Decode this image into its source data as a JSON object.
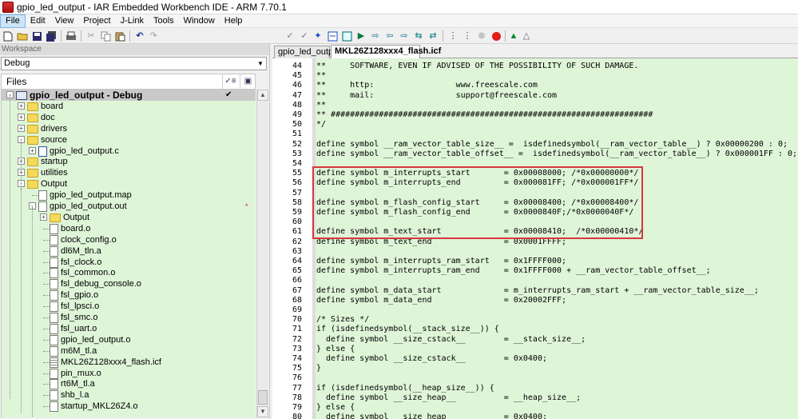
{
  "window": {
    "title": "gpio_led_output - IAR Embedded Workbench IDE - ARM 7.70.1"
  },
  "menu": [
    "File",
    "Edit",
    "View",
    "Project",
    "J-Link",
    "Tools",
    "Window",
    "Help"
  ],
  "workspace": {
    "header": "Workspace",
    "config": "Debug",
    "files_header": "Files",
    "tree": [
      {
        "label": "gpio_led_output - Debug",
        "depth": 0,
        "type": "project",
        "exp": "-",
        "bold": true,
        "selected": true,
        "check": "✔"
      },
      {
        "label": "board",
        "depth": 1,
        "type": "folder",
        "exp": "+"
      },
      {
        "label": "doc",
        "depth": 1,
        "type": "folder",
        "exp": "+"
      },
      {
        "label": "drivers",
        "depth": 1,
        "type": "folder",
        "exp": "+"
      },
      {
        "label": "source",
        "depth": 1,
        "type": "folder",
        "exp": "-"
      },
      {
        "label": "gpio_led_output.c",
        "depth": 2,
        "type": "cfile",
        "exp": "+"
      },
      {
        "label": "startup",
        "depth": 1,
        "type": "folder",
        "exp": "+"
      },
      {
        "label": "utilities",
        "depth": 1,
        "type": "folder",
        "exp": "+"
      },
      {
        "label": "Output",
        "depth": 1,
        "type": "folder",
        "exp": "-"
      },
      {
        "label": "gpio_led_output.map",
        "depth": 2,
        "type": "file",
        "exp": ""
      },
      {
        "label": "gpio_led_output.out",
        "depth": 2,
        "type": "file",
        "exp": "-",
        "mark": "*"
      },
      {
        "label": "Output",
        "depth": 3,
        "type": "folder",
        "exp": "+"
      },
      {
        "label": "board.o",
        "depth": 3,
        "type": "file",
        "exp": ""
      },
      {
        "label": "clock_config.o",
        "depth": 3,
        "type": "file",
        "exp": ""
      },
      {
        "label": "dl6M_tln.a",
        "depth": 3,
        "type": "file",
        "exp": ""
      },
      {
        "label": "fsl_clock.o",
        "depth": 3,
        "type": "file",
        "exp": ""
      },
      {
        "label": "fsl_common.o",
        "depth": 3,
        "type": "file",
        "exp": ""
      },
      {
        "label": "fsl_debug_console.o",
        "depth": 3,
        "type": "file",
        "exp": ""
      },
      {
        "label": "fsl_gpio.o",
        "depth": 3,
        "type": "file",
        "exp": ""
      },
      {
        "label": "fsl_lpsci.o",
        "depth": 3,
        "type": "file",
        "exp": ""
      },
      {
        "label": "fsl_smc.o",
        "depth": 3,
        "type": "file",
        "exp": ""
      },
      {
        "label": "fsl_uart.o",
        "depth": 3,
        "type": "file",
        "exp": ""
      },
      {
        "label": "gpio_led_output.o",
        "depth": 3,
        "type": "file",
        "exp": ""
      },
      {
        "label": "m6M_tl.a",
        "depth": 3,
        "type": "file",
        "exp": ""
      },
      {
        "label": "MKL26Z128xxx4_flash.icf",
        "depth": 3,
        "type": "filelines",
        "exp": ""
      },
      {
        "label": "pin_mux.o",
        "depth": 3,
        "type": "file",
        "exp": ""
      },
      {
        "label": "rt6M_tl.a",
        "depth": 3,
        "type": "file",
        "exp": ""
      },
      {
        "label": "shb_l.a",
        "depth": 3,
        "type": "file",
        "exp": ""
      },
      {
        "label": "startup_MKL26Z4.o",
        "depth": 3,
        "type": "file",
        "exp": ""
      }
    ]
  },
  "tabs": [
    {
      "label": "gpio_led_output",
      "active": false
    },
    {
      "label": "MKL26Z128xxx4_flash.icf",
      "active": true
    }
  ],
  "code": [
    {
      "n": "44",
      "t": "**     SOFTWARE, EVEN IF ADVISED OF THE POSSIBILITY OF SUCH DAMAGE."
    },
    {
      "n": "45",
      "t": "**"
    },
    {
      "n": "46",
      "t": "**     http:                 www.freescale.com"
    },
    {
      "n": "47",
      "t": "**     mail:                 support@freescale.com"
    },
    {
      "n": "48",
      "t": "**"
    },
    {
      "n": "49",
      "t": "** ###################################################################"
    },
    {
      "n": "50",
      "t": "*/"
    },
    {
      "n": "51",
      "t": ""
    },
    {
      "n": "52",
      "t": "define symbol __ram_vector_table_size__ =  isdefinedsymbol(__ram_vector_table__) ? 0x00000200 : 0;"
    },
    {
      "n": "53",
      "t": "define symbol __ram_vector_table_offset__ =  isdefinedsymbol(__ram_vector_table__) ? 0x000001FF : 0;"
    },
    {
      "n": "54",
      "t": ""
    },
    {
      "n": "55",
      "t": "define symbol m_interrupts_start       = 0x00008000; /*0x00000000*/"
    },
    {
      "n": "56",
      "t": "define symbol m_interrupts_end         = 0x000081FF; /*0x000001FF*/"
    },
    {
      "n": "57",
      "t": ""
    },
    {
      "n": "58",
      "t": "define symbol m_flash_config_start     = 0x00008400; /*0x00008400*/"
    },
    {
      "n": "59",
      "t": "define symbol m_flash_config_end       = 0x0000840F;/*0x0000040F*/"
    },
    {
      "n": "60",
      "t": ""
    },
    {
      "n": "61",
      "t": "define symbol m_text_start             = 0x00008410;  /*0x00000410*/"
    },
    {
      "n": "62",
      "t": "define symbol m_text_end               = 0x0001FFFF;"
    },
    {
      "n": "63",
      "t": ""
    },
    {
      "n": "64",
      "t": "define symbol m_interrupts_ram_start   = 0x1FFFF000;"
    },
    {
      "n": "65",
      "t": "define symbol m_interrupts_ram_end     = 0x1FFFF000 + __ram_vector_table_offset__;"
    },
    {
      "n": "66",
      "t": ""
    },
    {
      "n": "67",
      "t": "define symbol m_data_start             = m_interrupts_ram_start + __ram_vector_table_size__;"
    },
    {
      "n": "68",
      "t": "define symbol m_data_end               = 0x20002FFF;"
    },
    {
      "n": "69",
      "t": ""
    },
    {
      "n": "70",
      "t": "/* Sizes */"
    },
    {
      "n": "71",
      "t": "if (isdefinedsymbol(__stack_size__)) {"
    },
    {
      "n": "72",
      "t": "  define symbol __size_cstack__        = __stack_size__;"
    },
    {
      "n": "73",
      "t": "} else {"
    },
    {
      "n": "74",
      "t": "  define symbol __size_cstack__        = 0x0400;"
    },
    {
      "n": "75",
      "t": "}"
    },
    {
      "n": "76",
      "t": ""
    },
    {
      "n": "77",
      "t": "if (isdefinedsymbol(__heap_size__)) {"
    },
    {
      "n": "78",
      "t": "  define symbol __size_heap__          = __heap_size__;"
    },
    {
      "n": "79",
      "t": "} else {"
    },
    {
      "n": "80",
      "t": "  define symbol __size_heap__          = 0x0400;"
    }
  ],
  "colors": {
    "tree_bg": "#dff5d8",
    "editor_bg": "#dff5d8",
    "highlight_box": "#d9363e"
  }
}
